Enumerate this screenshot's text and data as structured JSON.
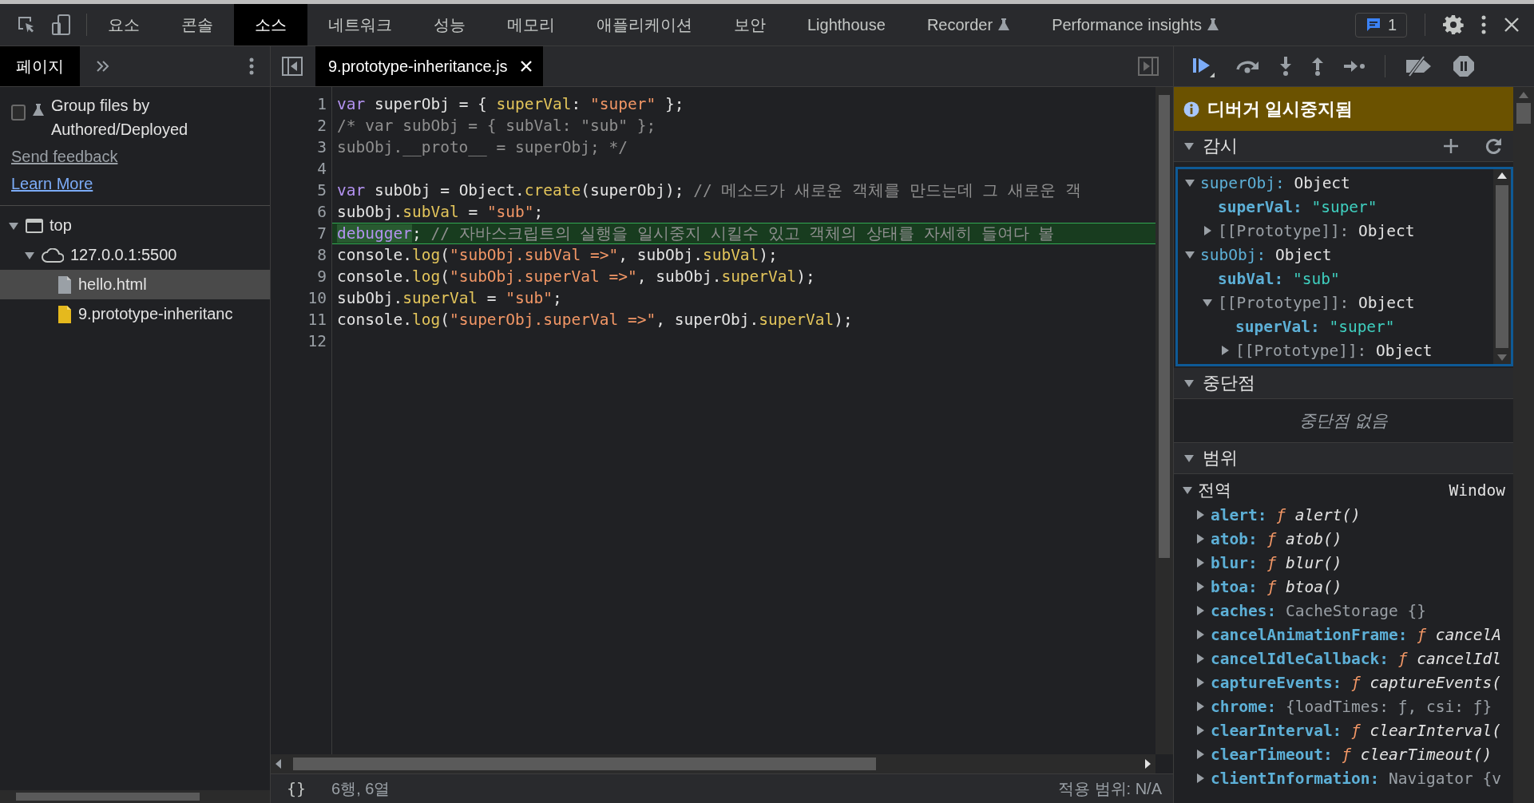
{
  "toolbar": {
    "tabs": [
      {
        "label": "요소",
        "selected": false,
        "experimental": false
      },
      {
        "label": "콘솔",
        "selected": false,
        "experimental": false
      },
      {
        "label": "소스",
        "selected": true,
        "experimental": false
      },
      {
        "label": "네트워크",
        "selected": false,
        "experimental": false
      },
      {
        "label": "성능",
        "selected": false,
        "experimental": false
      },
      {
        "label": "메모리",
        "selected": false,
        "experimental": false
      },
      {
        "label": "애플리케이션",
        "selected": false,
        "experimental": false
      },
      {
        "label": "보안",
        "selected": false,
        "experimental": false
      },
      {
        "label": "Lighthouse",
        "selected": false,
        "experimental": false
      },
      {
        "label": "Recorder",
        "selected": false,
        "experimental": true
      },
      {
        "label": "Performance insights",
        "selected": false,
        "experimental": true
      }
    ],
    "issues_count": "1"
  },
  "navigator": {
    "tabs": [
      {
        "label": "페이지",
        "selected": true
      }
    ],
    "group_files": {
      "label": "Group files by Authored/Deployed",
      "checked": false
    },
    "links": [
      {
        "label": "Send feedback",
        "kind": "feedback"
      },
      {
        "label": "Learn More",
        "kind": "learn"
      }
    ],
    "tree": [
      {
        "label": "top",
        "kind": "frame",
        "expanded": true,
        "selected": false,
        "children": [
          {
            "label": "127.0.0.1:5500",
            "kind": "origin",
            "expanded": true,
            "selected": false,
            "children": [
              {
                "label": "hello.html",
                "kind": "html",
                "selected": true
              },
              {
                "label": "9.prototype-inheritanc",
                "kind": "script",
                "selected": false
              }
            ]
          }
        ]
      }
    ]
  },
  "editor": {
    "tabs": [
      {
        "label": "9.prototype-inheritance.js",
        "selected": true
      }
    ],
    "lines": [
      {
        "number": "1",
        "current": false,
        "tokens": [
          {
            "kind": "keyword",
            "text": "var"
          },
          {
            "kind": "plain",
            "text": " superObj = { "
          },
          {
            "kind": "property",
            "text": "superVal"
          },
          {
            "kind": "plain",
            "text": ": "
          },
          {
            "kind": "string",
            "text": "\"super\""
          },
          {
            "kind": "plain",
            "text": " };"
          }
        ]
      },
      {
        "number": "2",
        "current": false,
        "tokens": [
          {
            "kind": "comment",
            "text": "/* var subObj = { subVal: \"sub\" };"
          }
        ]
      },
      {
        "number": "3",
        "current": false,
        "tokens": [
          {
            "kind": "comment",
            "text": "subObj.__proto__ = superObj; */"
          }
        ]
      },
      {
        "number": "4",
        "current": false
      },
      {
        "number": "5",
        "current": false,
        "tokens": [
          {
            "kind": "keyword",
            "text": "var"
          },
          {
            "kind": "plain",
            "text": " subObj = Object."
          },
          {
            "kind": "property",
            "text": "create"
          },
          {
            "kind": "plain",
            "text": "(superObj); "
          },
          {
            "kind": "comment",
            "text": "// 메소드가 새로운 객체를 만드는데 그 새로운 객"
          }
        ]
      },
      {
        "number": "6",
        "current": false,
        "tokens": [
          {
            "kind": "plain",
            "text": "subObj."
          },
          {
            "kind": "property",
            "text": "subVal"
          },
          {
            "kind": "plain",
            "text": " = "
          },
          {
            "kind": "string",
            "text": "\"sub\""
          },
          {
            "kind": "plain",
            "text": ";"
          }
        ]
      },
      {
        "number": "7",
        "current": true,
        "tokens": [
          {
            "kind": "execution",
            "text": "debugger"
          },
          {
            "kind": "plain",
            "text": "; "
          },
          {
            "kind": "comment",
            "text": "// 자바스크립트의 실행을 일시중지 시킬수 있고 객체의 상태를 자세히 들여다 볼"
          }
        ]
      },
      {
        "number": "8",
        "current": false,
        "tokens": [
          {
            "kind": "plain",
            "text": "console."
          },
          {
            "kind": "property",
            "text": "log"
          },
          {
            "kind": "plain",
            "text": "("
          },
          {
            "kind": "string",
            "text": "\"subObj.subVal =>\""
          },
          {
            "kind": "plain",
            "text": ", subObj."
          },
          {
            "kind": "property",
            "text": "subVal"
          },
          {
            "kind": "plain",
            "text": ");"
          }
        ]
      },
      {
        "number": "9",
        "current": false,
        "tokens": [
          {
            "kind": "plain",
            "text": "console."
          },
          {
            "kind": "property",
            "text": "log"
          },
          {
            "kind": "plain",
            "text": "("
          },
          {
            "kind": "string",
            "text": "\"subObj.superVal =>\""
          },
          {
            "kind": "plain",
            "text": ", subObj."
          },
          {
            "kind": "property",
            "text": "superVal"
          },
          {
            "kind": "plain",
            "text": ");"
          }
        ]
      },
      {
        "number": "10",
        "current": false,
        "tokens": [
          {
            "kind": "plain",
            "text": "subObj."
          },
          {
            "kind": "property",
            "text": "superVal"
          },
          {
            "kind": "plain",
            "text": " = "
          },
          {
            "kind": "string",
            "text": "\"sub\""
          },
          {
            "kind": "plain",
            "text": ";"
          }
        ]
      },
      {
        "number": "11",
        "current": false,
        "tokens": [
          {
            "kind": "plain",
            "text": "console."
          },
          {
            "kind": "property",
            "text": "log"
          },
          {
            "kind": "plain",
            "text": "("
          },
          {
            "kind": "string",
            "text": "\"superObj.superVal =>\""
          },
          {
            "kind": "plain",
            "text": ", superObj."
          },
          {
            "kind": "property",
            "text": "superVal"
          },
          {
            "kind": "plain",
            "text": ");"
          }
        ]
      },
      {
        "number": "12",
        "current": false
      }
    ]
  },
  "status_bar": {
    "format_button": "{}",
    "position": "6행, 6열",
    "coverage": "적용 범위: N/A"
  },
  "debugger": {
    "paused_banner": "디버거 일시중지됨",
    "watch": {
      "title": "감시",
      "expanded": true,
      "items": [
        {
          "name": "superObj:",
          "kind": "expression",
          "value": "Object",
          "expanded": true,
          "children": [
            {
              "name": "superVal:",
              "kind": "property",
              "value": "\"super\""
            },
            {
              "name": "[[Prototype]]:",
              "kind": "internal",
              "value": "Object",
              "expanded": false
            }
          ]
        },
        {
          "name": "subObj:",
          "kind": "expression",
          "value": "Object",
          "expanded": true,
          "children": [
            {
              "name": "subVal:",
              "kind": "property",
              "value": "\"sub\""
            },
            {
              "name": "[[Prototype]]:",
              "kind": "internal",
              "value": "Object",
              "expanded": true,
              "children": [
                {
                  "name": "superVal:",
                  "kind": "property",
                  "value": "\"super\""
                },
                {
                  "name": "[[Prototype]]:",
                  "kind": "internal",
                  "value": "Object",
                  "expanded": false
                }
              ]
            }
          ]
        }
      ]
    },
    "breakpoints": {
      "title": "중단점",
      "expanded": true,
      "empty": "중단점 없음"
    },
    "scope": {
      "title": "범위",
      "expanded": true,
      "groups": [
        {
          "label": "전역",
          "value": "Window",
          "expanded": true,
          "items": [
            {
              "name": "alert:",
              "kind": "function",
              "marker": "ƒ",
              "value": "alert()"
            },
            {
              "name": "atob:",
              "kind": "function",
              "marker": "ƒ",
              "value": "atob()"
            },
            {
              "name": "blur:",
              "kind": "function",
              "marker": "ƒ",
              "value": "blur()"
            },
            {
              "name": "btoa:",
              "kind": "function",
              "marker": "ƒ",
              "value": "btoa()"
            },
            {
              "name": "caches:",
              "kind": "object",
              "value": "CacheStorage {}"
            },
            {
              "name": "cancelAnimationFrame:",
              "kind": "function",
              "marker": "ƒ",
              "value": "cancelA"
            },
            {
              "name": "cancelIdleCallback:",
              "kind": "function",
              "marker": "ƒ",
              "value": "cancelIdl"
            },
            {
              "name": "captureEvents:",
              "kind": "function",
              "marker": "ƒ",
              "value": "captureEvents("
            },
            {
              "name": "chrome:",
              "kind": "object",
              "value": "{loadTimes: ƒ, csi: ƒ}"
            },
            {
              "name": "clearInterval:",
              "kind": "function",
              "marker": "ƒ",
              "value": "clearInterval("
            },
            {
              "name": "clearTimeout:",
              "kind": "function",
              "marker": "ƒ",
              "value": "clearTimeout()"
            },
            {
              "name": "clientInformation:",
              "kind": "object",
              "value": "Navigator {v"
            }
          ]
        }
      ]
    }
  }
}
